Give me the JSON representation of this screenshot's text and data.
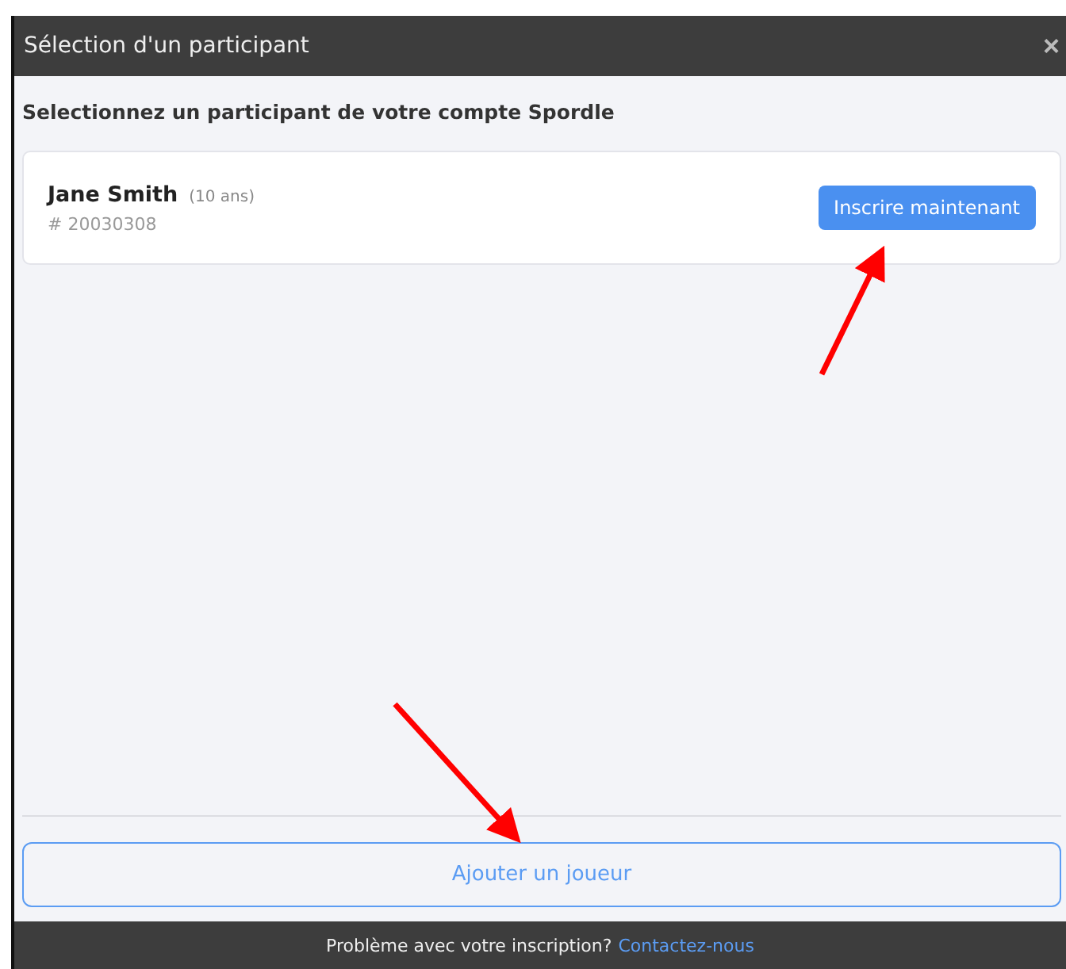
{
  "dialog": {
    "title": "Sélection d'un participant",
    "close": "×"
  },
  "instruction": "Selectionnez un participant de votre compte Spordle",
  "participants": [
    {
      "name": "Jane Smith",
      "age": "(10 ans)",
      "number": "# 20030308",
      "action": "Inscrire maintenant"
    }
  ],
  "add_button": "Ajouter un joueur",
  "footer": {
    "text": "Problème avec votre inscription?",
    "link": "Contactez-nous"
  }
}
